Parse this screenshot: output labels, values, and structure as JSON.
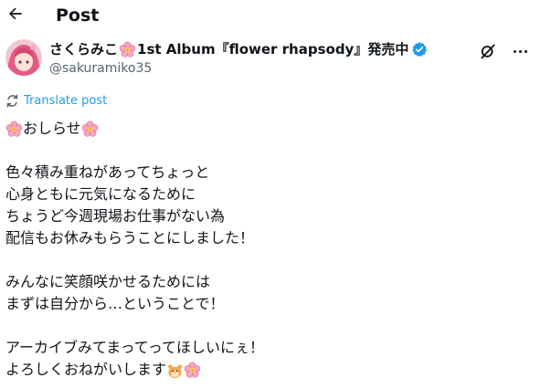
{
  "header": {
    "title": "Post"
  },
  "author": {
    "display_name": "さくらみこ",
    "album_text": "1st Album『flower rhapsody』発売中",
    "handle": "@sakuramiko35"
  },
  "translate_label": "Translate post",
  "post_lines": {
    "l1": "おしらせ",
    "l2": "色々積み重ねがあってちょっと",
    "l3": "心身ともに元気になるために",
    "l4": "ちょうど今週現場お仕事がない為",
    "l5": "配信もお休みもらうことにしました！",
    "l6": "みんなに笑顔咲かせるためには",
    "l7": "まずは自分から…ということで！",
    "l8": "アーカイブみてまってってほしいにぇ！",
    "l9": "よろしくおねがいします"
  },
  "colors": {
    "accent": "#1d9bf0",
    "verified": "#1d9bf0",
    "secondary_text": "#536471",
    "text": "#0f1419"
  },
  "icons": [
    "back-arrow-icon",
    "sakura-emoji-icon",
    "verified-badge-icon",
    "grok-icon",
    "more-icon",
    "translate-icon",
    "hamster-emoji-icon"
  ]
}
